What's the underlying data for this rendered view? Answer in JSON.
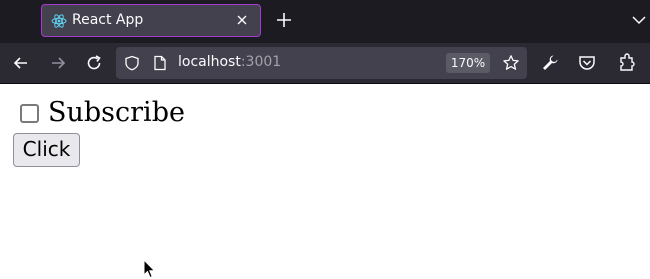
{
  "browser": {
    "tab": {
      "title": "React App",
      "close_icon": "close-icon",
      "favicon": "react-icon"
    },
    "new_tab_icon": "plus-icon",
    "list_tabs_icon": "chevron-down-icon",
    "nav": {
      "back_icon": "arrow-left-icon",
      "forward_icon": "arrow-right-icon",
      "reload_icon": "reload-icon"
    },
    "url": {
      "host": "localhost",
      "port": ":3001",
      "zoom": "170%"
    },
    "toolbar_icons": [
      "star-icon",
      "wrench-icon",
      "pocket-icon",
      "extensions-icon"
    ]
  },
  "page": {
    "checkbox": {
      "label": "Subscribe",
      "checked": false
    },
    "button_label": "Click"
  },
  "colors": {
    "tab_accent": "#a73bd1",
    "react_blue": "#61dafb"
  }
}
